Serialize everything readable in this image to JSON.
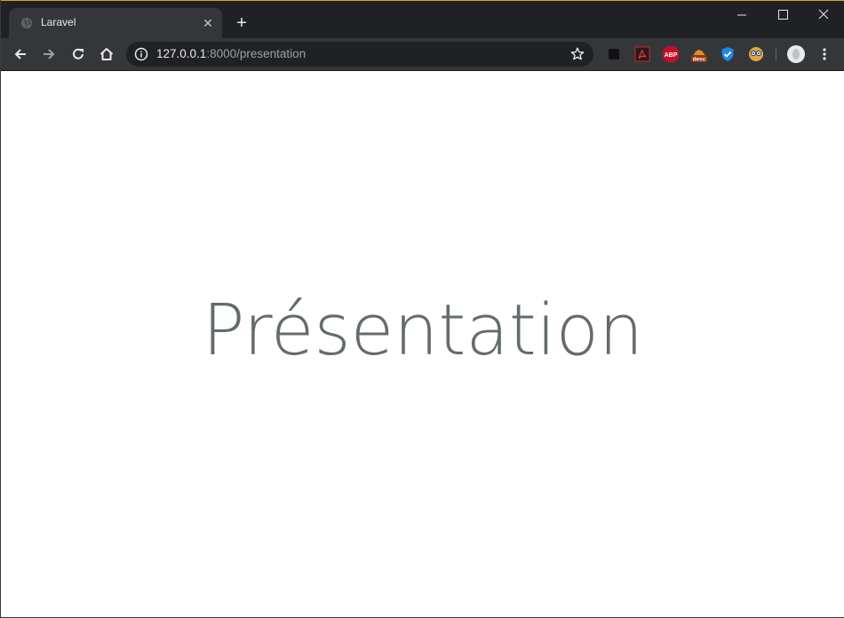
{
  "browser": {
    "tab": {
      "title": "Laravel",
      "favicon": "globe-icon",
      "close_glyph": "✕"
    },
    "new_tab_glyph": "+",
    "window_controls": [
      "minimize-icon",
      "maximize-icon",
      "close-icon"
    ],
    "toolbar": {
      "back": "back-arrow-icon",
      "forward": "forward-arrow-icon",
      "reload": "reload-icon",
      "home": "home-icon"
    },
    "address_bar": {
      "host": "127.0.0.1",
      "rest": ":8000/presentation",
      "info_icon": "info-icon",
      "bookmark_icon": "star-icon"
    },
    "extensions": [
      {
        "name": "black-square-extension-icon",
        "color": "#111111"
      },
      {
        "name": "pdf-extension-icon",
        "color": "#c62828"
      },
      {
        "name": "adblock-plus-icon",
        "label": "ABP",
        "color": "#c70d2c"
      },
      {
        "name": "desc-extension-icon",
        "label": "desc",
        "color": "#8d3b10"
      },
      {
        "name": "shield-check-icon",
        "color": "#1e88e5"
      },
      {
        "name": "owl-extension-icon",
        "color": "#e0a640"
      }
    ],
    "profile_icon": "profile-avatar-icon",
    "menu_icon": "kebab-menu-icon"
  },
  "page": {
    "heading": "Présentation"
  },
  "colors": {
    "tabstrip_bg": "#202124",
    "toolbar_bg": "#35363a",
    "heading_color": "#636b6f",
    "accent_top": "#d6a223"
  }
}
